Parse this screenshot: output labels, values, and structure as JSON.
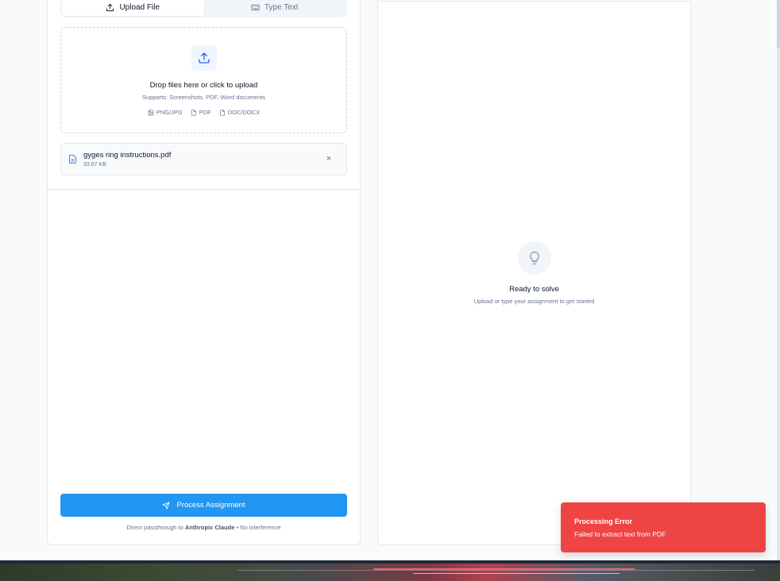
{
  "tabs": {
    "upload_label": "Upload File",
    "type_label": "Type Text"
  },
  "dropzone": {
    "title": "Drop files here or click to upload",
    "subtitle": "Supports: Screenshots, PDF, Word documents",
    "formats": [
      "PNG/JPG",
      "PDF",
      "DOC/DOCX"
    ]
  },
  "file": {
    "name": "gyges ring instructions.pdf",
    "size": "33.67 KB",
    "remove_glyph": "×"
  },
  "process_button": {
    "label": "Process Assignment"
  },
  "footnote": {
    "prefix": "Direct passthrough to",
    "brand": "Anthropic Claude",
    "suffix": "• No interference"
  },
  "ready": {
    "title": "Ready to solve",
    "subtitle": "Upload or type your assignment to get started"
  },
  "toast": {
    "title": "Processing Error",
    "message": "Failed to extract text from PDF"
  },
  "colors": {
    "accent": "#2196f3",
    "error": "#ef4444"
  }
}
